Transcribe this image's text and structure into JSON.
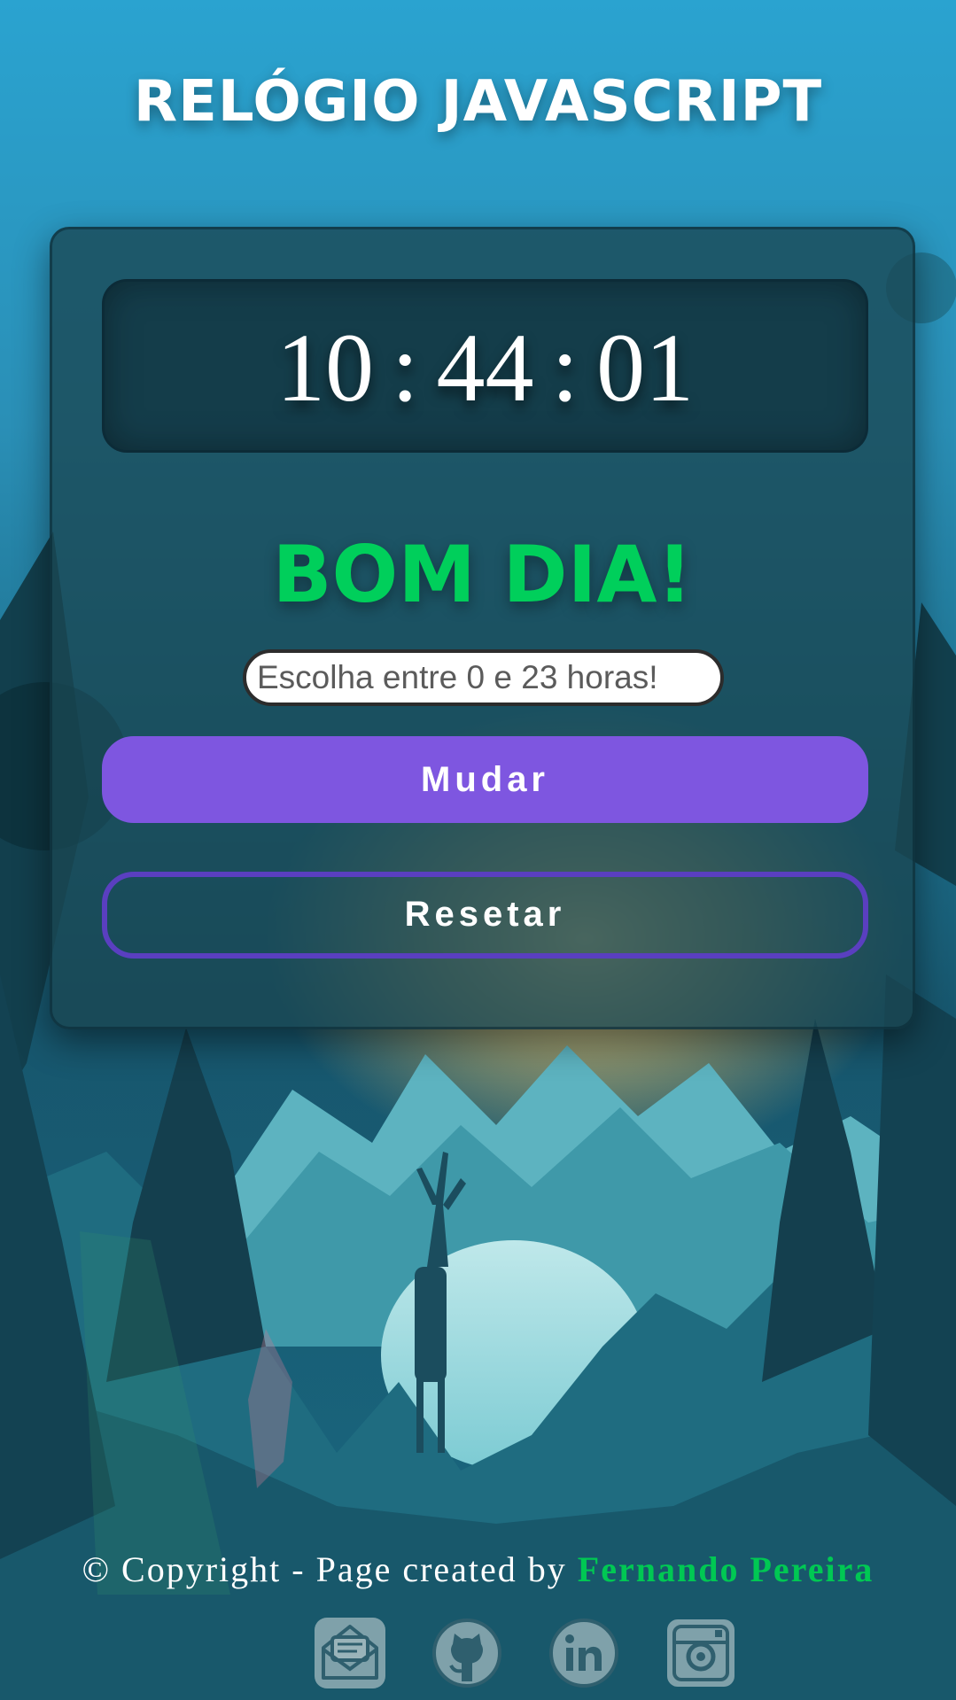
{
  "header": {
    "title": "RELÓGIO JAVASCRIPT"
  },
  "clock": {
    "hours": "10",
    "minutes": "44",
    "seconds": "01",
    "separator": ":"
  },
  "greeting": {
    "text": "BOM DIA!",
    "color": "#00cf5b"
  },
  "hour_input": {
    "value": "",
    "placeholder": "Escolha entre 0 e 23 horas!"
  },
  "buttons": {
    "change_label": "Mudar",
    "reset_label": "Resetar",
    "accent_color": "#7e56e0"
  },
  "footer": {
    "copyright_text": "© Copyright - Page created by",
    "author": "Fernando Pereira",
    "author_color": "#00c853"
  },
  "social_links": [
    {
      "icon": "email-icon"
    },
    {
      "icon": "github-icon"
    },
    {
      "icon": "linkedin-icon"
    },
    {
      "icon": "instagram-icon"
    }
  ]
}
